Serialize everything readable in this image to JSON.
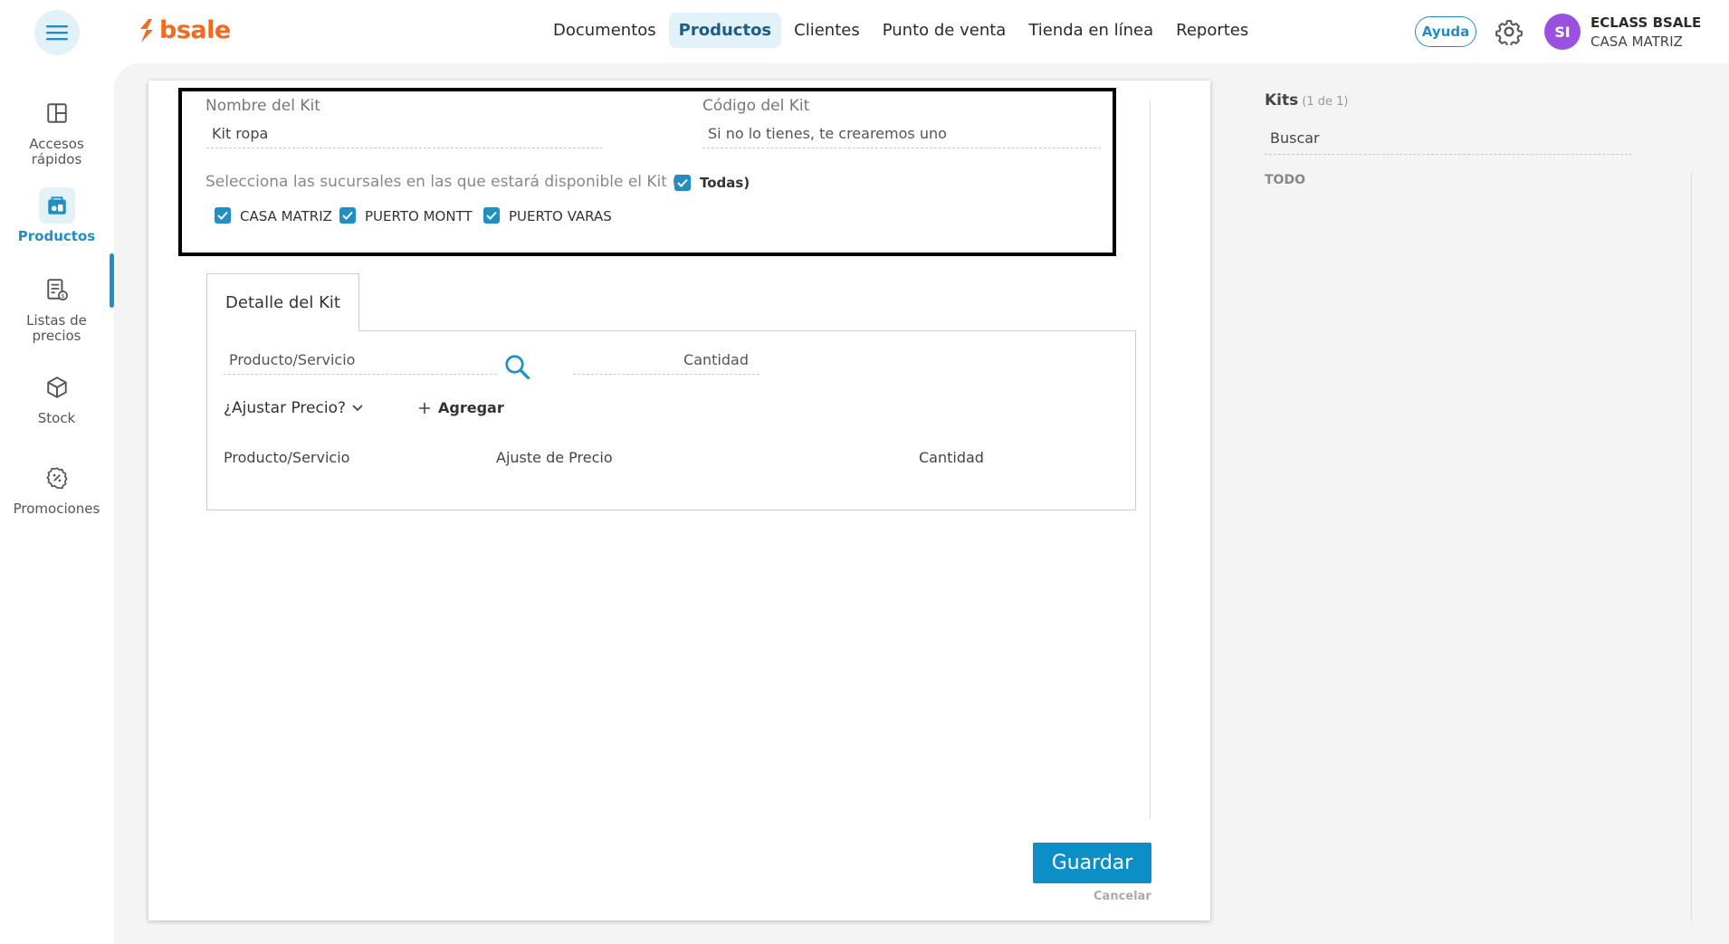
{
  "brand": {
    "name": "bsale",
    "color": "#f26a21",
    "accent": "#1f8fc5"
  },
  "nav": {
    "items": [
      {
        "label": "Documentos",
        "active": false
      },
      {
        "label": "Productos",
        "active": true
      },
      {
        "label": "Clientes",
        "active": false
      },
      {
        "label": "Punto de venta",
        "active": false
      },
      {
        "label": "Tienda en línea",
        "active": false
      },
      {
        "label": "Reportes",
        "active": false
      }
    ]
  },
  "header": {
    "help_label": "Ayuda",
    "avatar_initials": "SI",
    "user_name": "ECLASS BSALE",
    "user_branch": "CASA MATRIZ"
  },
  "sidebar": {
    "items": [
      {
        "label": "Accesos rápidos",
        "icon": "layout-grid-icon"
      },
      {
        "label": "Productos",
        "icon": "products-icon",
        "active": true
      },
      {
        "label": "Listas de precios",
        "icon": "price-list-icon"
      },
      {
        "label": "Stock",
        "icon": "box-icon"
      },
      {
        "label": "Promociones",
        "icon": "discount-badge-icon"
      }
    ]
  },
  "form": {
    "name_label": "Nombre del Kit",
    "name_value": "Kit ropa",
    "code_label": "Código del Kit",
    "code_placeholder": "Si no lo tienes, te crearemos uno",
    "branches_text": "Selecciona las sucursales en las que estará disponible el Kit (",
    "all_label": "Todas)",
    "branches": [
      "CASA MATRIZ",
      "PUERTO MONTT",
      "PUERTO VARAS"
    ]
  },
  "detail": {
    "tab_label": "Detalle del Kit",
    "product_placeholder": "Producto/Servicio",
    "quantity_placeholder": "Cantidad",
    "adjust_label": "¿Ajustar Precio?",
    "add_label": "Agregar",
    "columns": [
      "Producto/Servicio",
      "Ajuste de Precio",
      "Cantidad"
    ]
  },
  "actions": {
    "save_label": "Guardar",
    "cancel_label": "Cancelar"
  },
  "kits_panel": {
    "title": "Kits",
    "count": "(1 de 1)",
    "search_placeholder": "Buscar",
    "filter_label": "TODO"
  }
}
